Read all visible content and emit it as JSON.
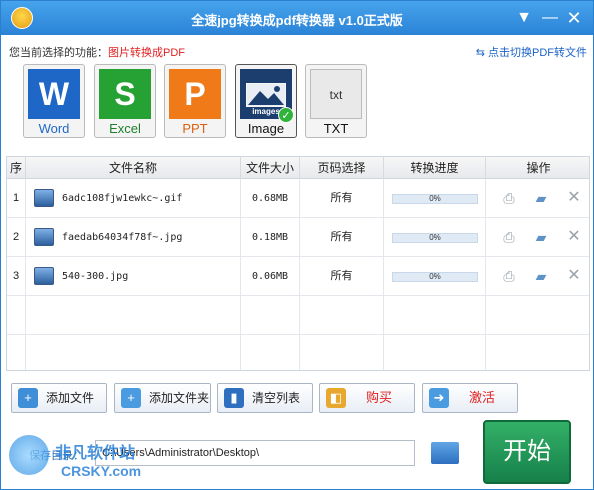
{
  "window": {
    "title": "全速jpg转换成pdf转换器 v1.0正式版"
  },
  "titlebar": {
    "menu_glyph": "▼",
    "min_glyph": "—",
    "close_glyph": "✕"
  },
  "function": {
    "prompt": "您当前选择的功能：",
    "current": "图片转换成PDF",
    "switch_label": "点击切换PDF转文件",
    "switch_glyph": "⇆"
  },
  "formats": [
    {
      "label": "Word",
      "glyph": "W"
    },
    {
      "label": "Excel",
      "glyph": "S"
    },
    {
      "label": "PPT",
      "glyph": "P"
    },
    {
      "label": "Image",
      "glyph": "images",
      "selected": true
    },
    {
      "label": "TXT",
      "glyph": "txt"
    }
  ],
  "table": {
    "headers": [
      "序",
      "文件名称",
      "文件大小",
      "页码选择",
      "转换进度",
      "操作"
    ],
    "rows": [
      {
        "index": "1",
        "name": "6adc108fjw1ewkc~.gif",
        "size": "0.68MB",
        "pages": "所有",
        "progress_text": "0%",
        "progress": 0
      },
      {
        "index": "2",
        "name": "faedab64034f78f~.jpg",
        "size": "0.18MB",
        "pages": "所有",
        "progress_text": "0%",
        "progress": 0
      },
      {
        "index": "3",
        "name": "540-300.jpg",
        "size": "0.06MB",
        "pages": "所有",
        "progress_text": "0%",
        "progress": 0
      }
    ],
    "icons": [
      "print-icon",
      "folder-icon",
      "delete-icon"
    ]
  },
  "buttons": {
    "add_file": "添加文件",
    "add_folder": "添加文件夹",
    "clear": "清空列表",
    "buy": "购买",
    "activate": "激活"
  },
  "output": {
    "label": "保存目录：",
    "path": "C:\\Users\\Administrator\\Desktop\\"
  },
  "start": "开始",
  "watermark": {
    "brand": "非凡软件站",
    "sub": "CRSKY.com"
  },
  "colors": {
    "title_bar": "#2b83d6",
    "accent_red": "#e02020",
    "start_green": "#1f8f52"
  }
}
